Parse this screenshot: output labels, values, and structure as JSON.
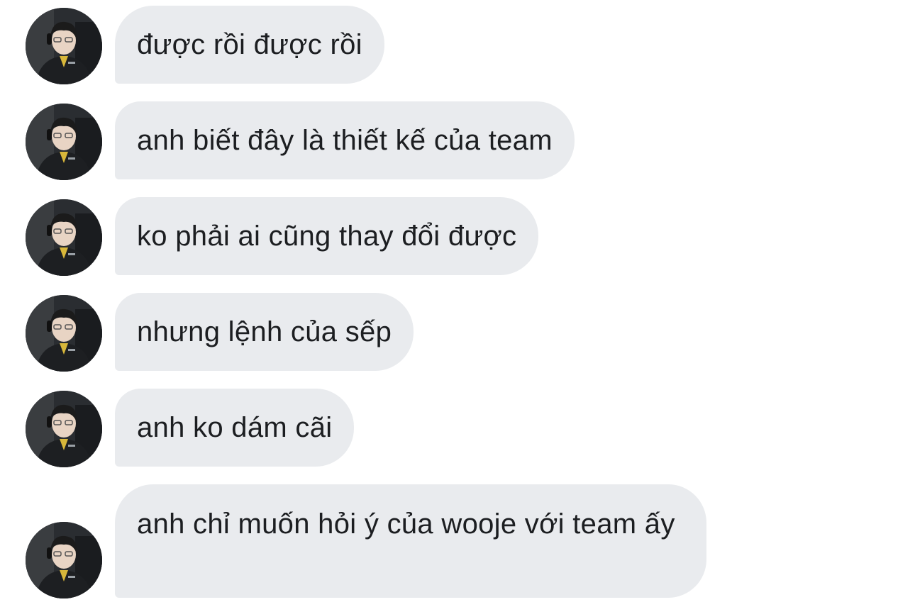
{
  "conversation": {
    "messages": [
      {
        "text": "được rồi được rồi",
        "avatar": "profile-photo"
      },
      {
        "text": "anh biết đây là thiết kế của team",
        "avatar": "profile-photo"
      },
      {
        "text": "ko phải ai cũng thay đổi được",
        "avatar": "profile-photo"
      },
      {
        "text": "nhưng lệnh của sếp",
        "avatar": "profile-photo"
      },
      {
        "text": "anh ko dám cãi",
        "avatar": "profile-photo"
      },
      {
        "text": "anh chỉ muốn hỏi ý của wooje với team ấy",
        "avatar": "profile-photo"
      }
    ]
  },
  "theme": {
    "bubble_color": "#e9ebee",
    "text_color": "#1c1e21",
    "background": "#ffffff"
  }
}
